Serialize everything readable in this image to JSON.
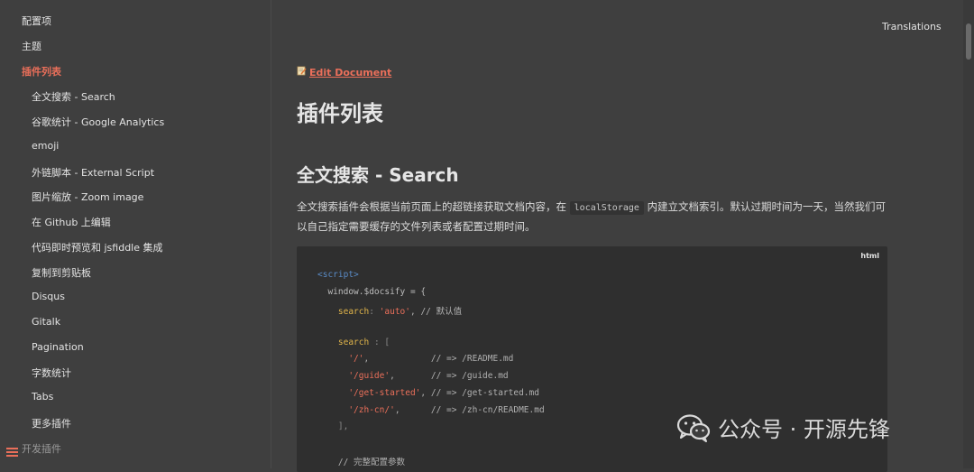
{
  "sidebar": {
    "items": [
      {
        "label": "配置项"
      },
      {
        "label": "主题"
      },
      {
        "label": "插件列表"
      },
      {
        "label": "全文搜索 - Search"
      },
      {
        "label": "谷歌统计 - Google Analytics"
      },
      {
        "label": "emoji"
      },
      {
        "label": "外链脚本 - External Script"
      },
      {
        "label": "图片缩放 - Zoom image"
      },
      {
        "label": "在 Github 上编辑"
      },
      {
        "label": "代码即时预览和 jsfiddle 集成"
      },
      {
        "label": "复制到剪贴板"
      },
      {
        "label": "Disqus"
      },
      {
        "label": "Gitalk"
      },
      {
        "label": "Pagination"
      },
      {
        "label": "字数统计"
      },
      {
        "label": "Tabs"
      },
      {
        "label": "更多插件"
      },
      {
        "label": "开发插件"
      }
    ],
    "menu_icon": "hamburger-icon"
  },
  "header": {
    "translations": "Translations"
  },
  "main": {
    "edit_document": "Edit Document",
    "edit_icon": "memo-pencil-icon",
    "title": "插件列表",
    "section_title_cn": "全文搜索",
    "section_title_en": "- Search",
    "paragraph_part1": "全文搜索插件会根据当前页面上的超链接获取文档内容，在",
    "paragraph_code": "localStorage",
    "paragraph_part2": "内建立文档索引。默认过期时间为一天，当然我们可以自己指定需要缓存的文件列表或者配置过期时间。",
    "code_lang": "html",
    "code_lines": [
      {
        "indent": "",
        "tag": "<script>"
      },
      {
        "indent": "  ",
        "text": "window.$docsify = {"
      },
      {
        "indent": "    ",
        "key": "search",
        "sep": ": ",
        "str": "'auto'",
        "rest": ", // 默认值"
      },
      {
        "indent": "",
        "text": ""
      },
      {
        "indent": "    ",
        "key": "search",
        "sep": " : [",
        "rest": ""
      },
      {
        "indent": "      ",
        "str": "'/'",
        "rest": ",            // => /README.md"
      },
      {
        "indent": "      ",
        "str": "'/guide'",
        "rest": ",       // => /guide.md"
      },
      {
        "indent": "      ",
        "str": "'/get-started'",
        "rest": ", // => /get-started.md"
      },
      {
        "indent": "      ",
        "str": "'/zh-cn/'",
        "rest": ",      // => /zh-cn/README.md"
      },
      {
        "indent": "    ",
        "text": "],"
      },
      {
        "indent": "",
        "text": ""
      },
      {
        "indent": "    ",
        "text": "// 完整配置参数"
      }
    ]
  },
  "watermark": {
    "text": "公众号 · 开源先锋",
    "icon": "wechat-icon"
  },
  "colors": {
    "background": "#3f3f3f",
    "accent": "#ea6f5a",
    "code_bg": "#2f2f2f"
  }
}
